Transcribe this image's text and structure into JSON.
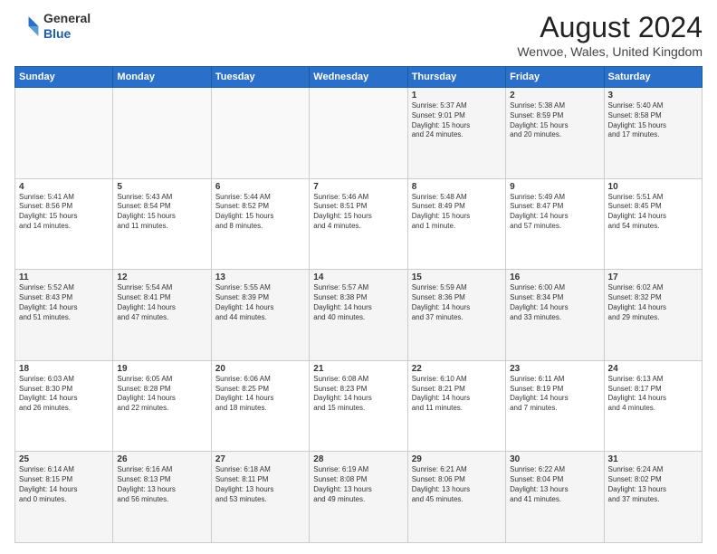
{
  "header": {
    "logo_line1": "General",
    "logo_line2": "Blue",
    "title": "August 2024",
    "location": "Wenvoe, Wales, United Kingdom"
  },
  "days_of_week": [
    "Sunday",
    "Monday",
    "Tuesday",
    "Wednesday",
    "Thursday",
    "Friday",
    "Saturday"
  ],
  "weeks": [
    [
      {
        "day": "",
        "info": ""
      },
      {
        "day": "",
        "info": ""
      },
      {
        "day": "",
        "info": ""
      },
      {
        "day": "",
        "info": ""
      },
      {
        "day": "1",
        "info": "Sunrise: 5:37 AM\nSunset: 9:01 PM\nDaylight: 15 hours\nand 24 minutes."
      },
      {
        "day": "2",
        "info": "Sunrise: 5:38 AM\nSunset: 8:59 PM\nDaylight: 15 hours\nand 20 minutes."
      },
      {
        "day": "3",
        "info": "Sunrise: 5:40 AM\nSunset: 8:58 PM\nDaylight: 15 hours\nand 17 minutes."
      }
    ],
    [
      {
        "day": "4",
        "info": "Sunrise: 5:41 AM\nSunset: 8:56 PM\nDaylight: 15 hours\nand 14 minutes."
      },
      {
        "day": "5",
        "info": "Sunrise: 5:43 AM\nSunset: 8:54 PM\nDaylight: 15 hours\nand 11 minutes."
      },
      {
        "day": "6",
        "info": "Sunrise: 5:44 AM\nSunset: 8:52 PM\nDaylight: 15 hours\nand 8 minutes."
      },
      {
        "day": "7",
        "info": "Sunrise: 5:46 AM\nSunset: 8:51 PM\nDaylight: 15 hours\nand 4 minutes."
      },
      {
        "day": "8",
        "info": "Sunrise: 5:48 AM\nSunset: 8:49 PM\nDaylight: 15 hours\nand 1 minute."
      },
      {
        "day": "9",
        "info": "Sunrise: 5:49 AM\nSunset: 8:47 PM\nDaylight: 14 hours\nand 57 minutes."
      },
      {
        "day": "10",
        "info": "Sunrise: 5:51 AM\nSunset: 8:45 PM\nDaylight: 14 hours\nand 54 minutes."
      }
    ],
    [
      {
        "day": "11",
        "info": "Sunrise: 5:52 AM\nSunset: 8:43 PM\nDaylight: 14 hours\nand 51 minutes."
      },
      {
        "day": "12",
        "info": "Sunrise: 5:54 AM\nSunset: 8:41 PM\nDaylight: 14 hours\nand 47 minutes."
      },
      {
        "day": "13",
        "info": "Sunrise: 5:55 AM\nSunset: 8:39 PM\nDaylight: 14 hours\nand 44 minutes."
      },
      {
        "day": "14",
        "info": "Sunrise: 5:57 AM\nSunset: 8:38 PM\nDaylight: 14 hours\nand 40 minutes."
      },
      {
        "day": "15",
        "info": "Sunrise: 5:59 AM\nSunset: 8:36 PM\nDaylight: 14 hours\nand 37 minutes."
      },
      {
        "day": "16",
        "info": "Sunrise: 6:00 AM\nSunset: 8:34 PM\nDaylight: 14 hours\nand 33 minutes."
      },
      {
        "day": "17",
        "info": "Sunrise: 6:02 AM\nSunset: 8:32 PM\nDaylight: 14 hours\nand 29 minutes."
      }
    ],
    [
      {
        "day": "18",
        "info": "Sunrise: 6:03 AM\nSunset: 8:30 PM\nDaylight: 14 hours\nand 26 minutes."
      },
      {
        "day": "19",
        "info": "Sunrise: 6:05 AM\nSunset: 8:28 PM\nDaylight: 14 hours\nand 22 minutes."
      },
      {
        "day": "20",
        "info": "Sunrise: 6:06 AM\nSunset: 8:25 PM\nDaylight: 14 hours\nand 18 minutes."
      },
      {
        "day": "21",
        "info": "Sunrise: 6:08 AM\nSunset: 8:23 PM\nDaylight: 14 hours\nand 15 minutes."
      },
      {
        "day": "22",
        "info": "Sunrise: 6:10 AM\nSunset: 8:21 PM\nDaylight: 14 hours\nand 11 minutes."
      },
      {
        "day": "23",
        "info": "Sunrise: 6:11 AM\nSunset: 8:19 PM\nDaylight: 14 hours\nand 7 minutes."
      },
      {
        "day": "24",
        "info": "Sunrise: 6:13 AM\nSunset: 8:17 PM\nDaylight: 14 hours\nand 4 minutes."
      }
    ],
    [
      {
        "day": "25",
        "info": "Sunrise: 6:14 AM\nSunset: 8:15 PM\nDaylight: 14 hours\nand 0 minutes."
      },
      {
        "day": "26",
        "info": "Sunrise: 6:16 AM\nSunset: 8:13 PM\nDaylight: 13 hours\nand 56 minutes."
      },
      {
        "day": "27",
        "info": "Sunrise: 6:18 AM\nSunset: 8:11 PM\nDaylight: 13 hours\nand 53 minutes."
      },
      {
        "day": "28",
        "info": "Sunrise: 6:19 AM\nSunset: 8:08 PM\nDaylight: 13 hours\nand 49 minutes."
      },
      {
        "day": "29",
        "info": "Sunrise: 6:21 AM\nSunset: 8:06 PM\nDaylight: 13 hours\nand 45 minutes."
      },
      {
        "day": "30",
        "info": "Sunrise: 6:22 AM\nSunset: 8:04 PM\nDaylight: 13 hours\nand 41 minutes."
      },
      {
        "day": "31",
        "info": "Sunrise: 6:24 AM\nSunset: 8:02 PM\nDaylight: 13 hours\nand 37 minutes."
      }
    ]
  ]
}
